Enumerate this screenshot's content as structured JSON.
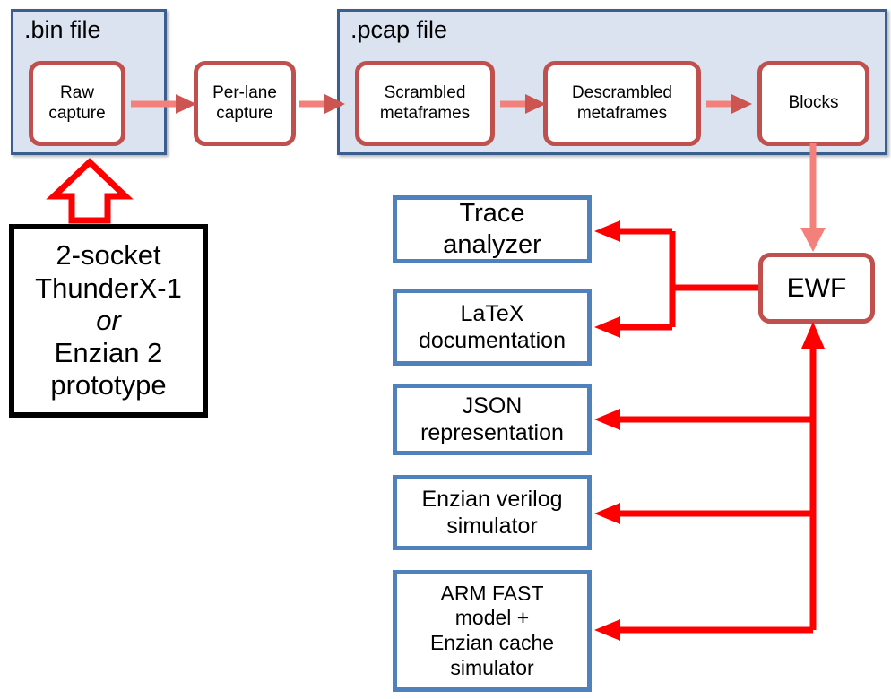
{
  "colors": {
    "panel_fill": "#dce3f0",
    "panel_border": "#3a5f8f",
    "stage_border": "#c0504d",
    "stage_fill": "#ffffff",
    "out_border": "#4f81bd",
    "wire_red": "#ff0000",
    "wire_salmon": "#f4807c",
    "wire_salmon_head": "#cc5552",
    "hw_border": "#000000",
    "text": "#000000"
  },
  "panels": [
    {
      "title": ".bin file",
      "stages": [
        {
          "lines": [
            "Raw",
            "capture"
          ]
        },
        {
          "lines": [
            "Per-lane",
            "capture"
          ]
        }
      ]
    },
    {
      "title": ".pcap file",
      "stages": [
        {
          "lines": [
            "Scrambled",
            "metaframes"
          ]
        },
        {
          "lines": [
            "Descrambled",
            "metaframes"
          ]
        },
        {
          "lines": [
            "Blocks"
          ]
        }
      ]
    }
  ],
  "hardware": {
    "lines": [
      "2-socket",
      "ThunderX-1",
      "or",
      "Enzian 2",
      "prototype"
    ],
    "italic_line_index": 2
  },
  "ewf": {
    "label": "EWF"
  },
  "outputs": [
    {
      "lines": [
        "Trace",
        "analyzer"
      ],
      "size": "big"
    },
    {
      "lines": [
        "LaTeX",
        "documentation"
      ],
      "size": "mid"
    },
    {
      "lines": [
        "JSON",
        "representation"
      ],
      "size": "mid"
    },
    {
      "lines": [
        "Enzian  verilog",
        "simulator"
      ],
      "size": "mid"
    },
    {
      "lines": [
        "ARM FAST",
        "model +",
        "Enzian  cache",
        "simulator"
      ],
      "size": "sml"
    }
  ],
  "connectors": {
    "stage_to_stage_arrow": "salmon-right-arrow",
    "panel_to_panel_arrow": "salmon-right-arrow",
    "blocks_to_ewf_arrow": "salmon-down-arrow",
    "hw_to_bin_arrow": "hollow-red-up-arrow",
    "ewf_to_outputs_arrow": "red-left-arrow",
    "outputs_to_ewf_arrow": "red-up-arrow"
  }
}
